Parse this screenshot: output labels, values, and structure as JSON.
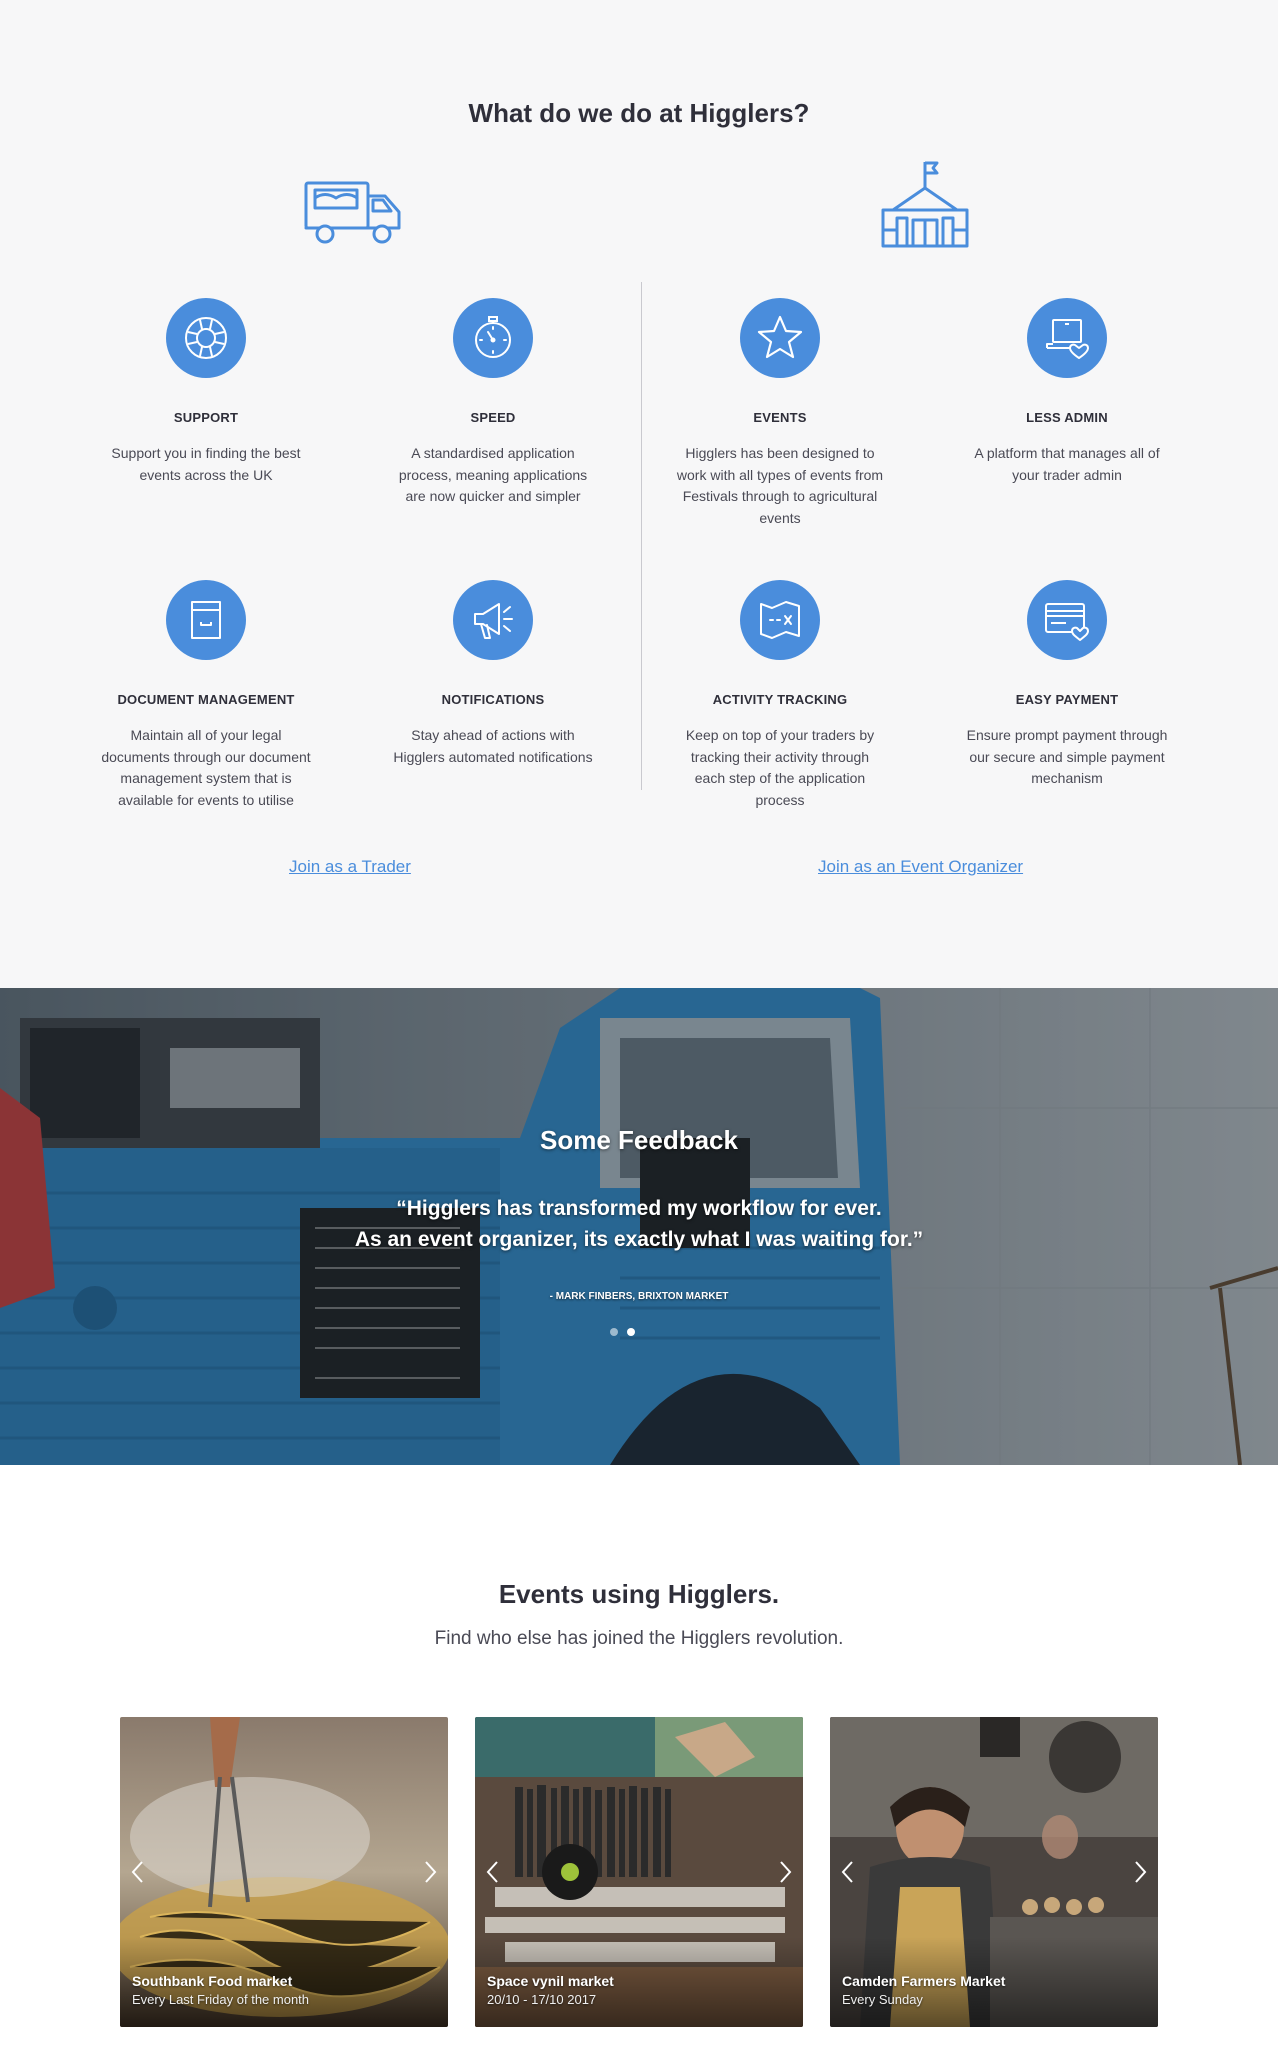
{
  "what_section": {
    "title": "What do we do at Higglers?",
    "trader_icon": "food-truck-icon",
    "organizer_icon": "event-tent-icon",
    "features": [
      {
        "key": "support",
        "icon": "lifebuoy-icon",
        "title": "SUPPORT",
        "desc": "Support you in finding the best events across the UK"
      },
      {
        "key": "speed",
        "icon": "stopwatch-icon",
        "title": "SPEED",
        "desc": "A standardised application process, meaning applications are now quicker and simpler"
      },
      {
        "key": "events",
        "icon": "star-icon",
        "title": "EVENTS",
        "desc": "Higglers has been designed to work with all types of events from Festivals through to agricultural events"
      },
      {
        "key": "less-admin",
        "icon": "laptop-heart-icon",
        "title": "LESS ADMIN",
        "desc": "A platform that manages all of your trader admin"
      },
      {
        "key": "document-management",
        "icon": "archive-box-icon",
        "title": "DOCUMENT MANAGEMENT",
        "desc": "Maintain all of your legal documents through our document management system that is available for events to utilise"
      },
      {
        "key": "notifications",
        "icon": "megaphone-icon",
        "title": "NOTIFICATIONS",
        "desc": "Stay ahead of actions with Higglers automated notifications"
      },
      {
        "key": "activity-tracking",
        "icon": "treasure-map-icon",
        "title": "ACTIVITY TRACKING",
        "desc": "Keep on top of your traders by tracking their activity through each step of the application process"
      },
      {
        "key": "easy-payment",
        "icon": "credit-card-heart-icon",
        "title": "EASY PAYMENT",
        "desc": "Ensure prompt payment through our secure and simple payment mechanism"
      }
    ],
    "join_trader": "Join as a Trader",
    "join_organizer": "Join as an Event Organizer"
  },
  "feedback": {
    "title": "Some Feedback",
    "quote_line1": "“Higglers has transformed my workflow for ever.",
    "quote_line2": "As an event organizer, its exactly what I was waiting for.”",
    "author": "- MARK FINBERS, BRIXTON MARKET",
    "slides": 2,
    "active_slide": 2
  },
  "events_section": {
    "title": "Events using Higglers.",
    "subtitle": "Find who else has joined the Higglers revolution.",
    "cards": [
      {
        "name": "Southbank Food market",
        "date": "Every Last Friday of the month"
      },
      {
        "name": "Space vynil market",
        "date": "20/10 - 17/10 2017"
      },
      {
        "name": "Camden Farmers Market",
        "date": "Every Sunday"
      }
    ]
  },
  "colors": {
    "accent": "#4a8ddc",
    "text_dark": "#2f2f3a",
    "background": "#f7f7f8",
    "truck_blue": "#2f7fb8"
  }
}
